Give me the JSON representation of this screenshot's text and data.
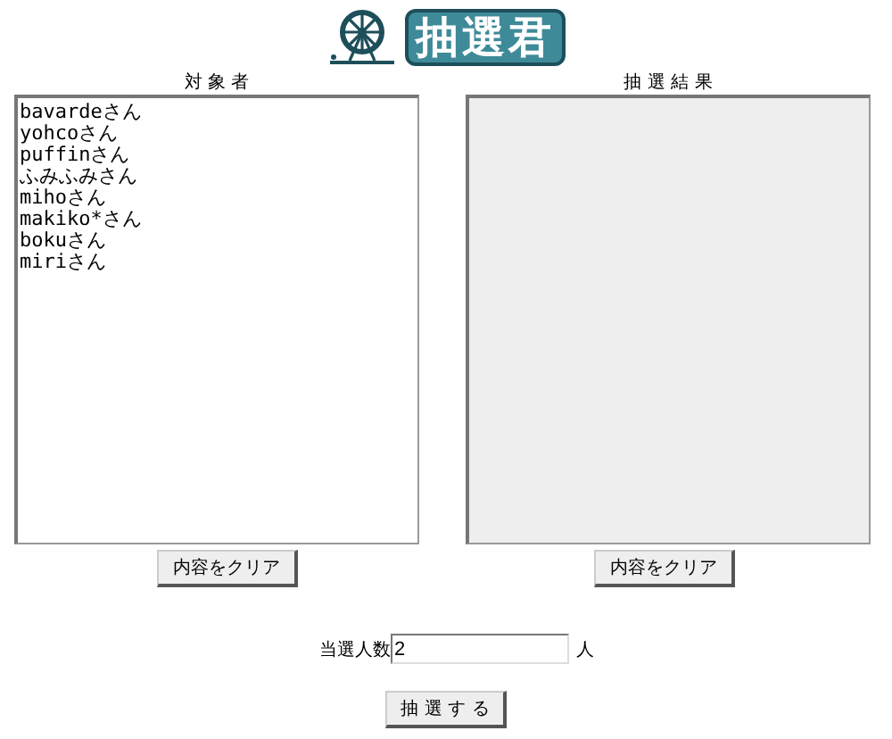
{
  "logo": {
    "title": "抽選君"
  },
  "candidates": {
    "heading": "対 象 者",
    "entries": [
      "bavardeさん",
      "yohcoさん",
      "puffinさん",
      "ふみふみさん",
      "mihoさん",
      "makiko*さん",
      "bokuさん",
      "miriさん"
    ],
    "disabled": false,
    "clear_button": "内容をクリア"
  },
  "results": {
    "heading": "抽 選 結 果",
    "disabled": true,
    "clear_button": "内容をクリア"
  },
  "winner_count": {
    "label": "当選人数",
    "value": "2",
    "unit": "人"
  },
  "draw_button": "抽 選 す る"
}
